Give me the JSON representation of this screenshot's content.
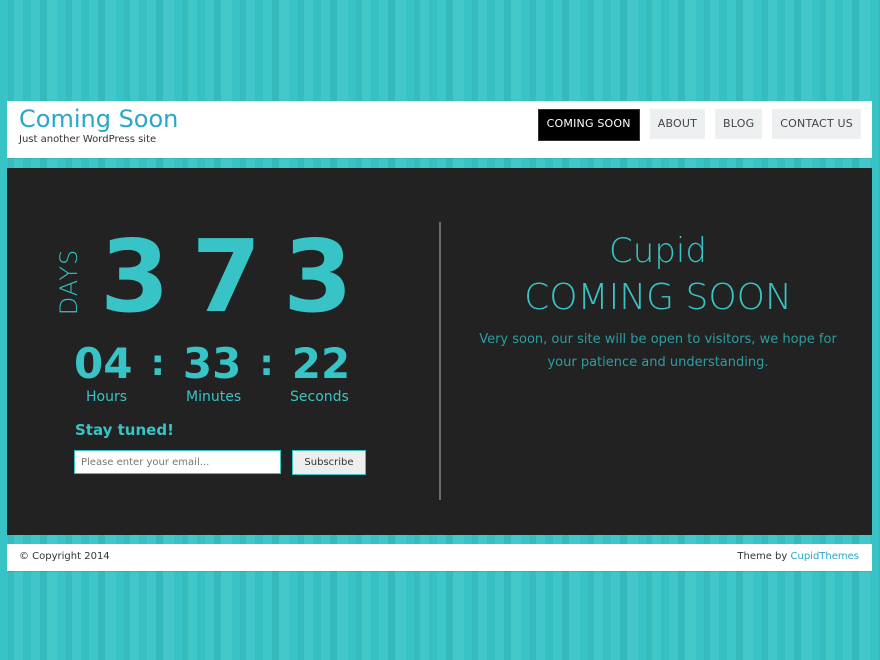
{
  "header": {
    "site_title": "Coming Soon",
    "site_description": "Just another WordPress site",
    "nav": [
      {
        "label": "COMING SOON",
        "active": true
      },
      {
        "label": "ABOUT",
        "active": false
      },
      {
        "label": "BLOG",
        "active": false
      },
      {
        "label": "CONTACT US",
        "active": false
      }
    ]
  },
  "countdown": {
    "days_label": "DAYS",
    "days": "373",
    "hours": "04",
    "minutes": "33",
    "seconds": "22",
    "separator": ":",
    "hours_label": "Hours",
    "minutes_label": "Minutes",
    "seconds_label": "Seconds"
  },
  "subscribe": {
    "heading": "Stay tuned!",
    "email_value": "",
    "email_placeholder": "Please enter your email...",
    "button_label": "Subscribe"
  },
  "hero": {
    "title": "Cupid",
    "subtitle": "COMING SOON",
    "description": "Very soon, our site will be open to visitors, we hope for your patience and understanding."
  },
  "footer": {
    "copyright": "© Copyright 2014",
    "theme_prefix": "Theme by ",
    "theme_link": "CupidThemes"
  },
  "colors": {
    "accent": "#38c4c6",
    "link": "#2aa6c9",
    "panel": "#222222",
    "nav_active_bg": "#000000",
    "nav_bg": "#edf0f1"
  }
}
